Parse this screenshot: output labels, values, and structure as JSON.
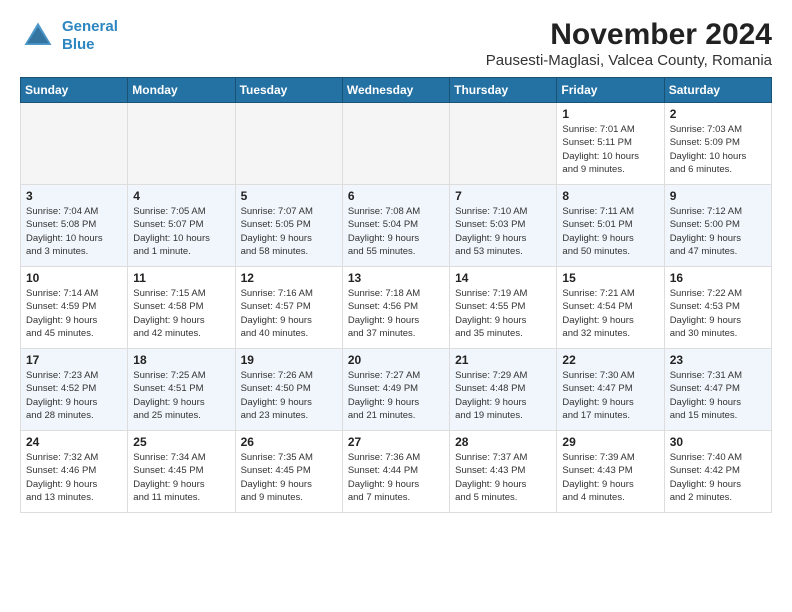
{
  "header": {
    "logo_line1": "General",
    "logo_line2": "Blue",
    "title": "November 2024",
    "subtitle": "Pausesti-Maglasi, Valcea County, Romania"
  },
  "days_of_week": [
    "Sunday",
    "Monday",
    "Tuesday",
    "Wednesday",
    "Thursday",
    "Friday",
    "Saturday"
  ],
  "weeks": [
    [
      {
        "day": "",
        "info": ""
      },
      {
        "day": "",
        "info": ""
      },
      {
        "day": "",
        "info": ""
      },
      {
        "day": "",
        "info": ""
      },
      {
        "day": "",
        "info": ""
      },
      {
        "day": "1",
        "info": "Sunrise: 7:01 AM\nSunset: 5:11 PM\nDaylight: 10 hours\nand 9 minutes."
      },
      {
        "day": "2",
        "info": "Sunrise: 7:03 AM\nSunset: 5:09 PM\nDaylight: 10 hours\nand 6 minutes."
      }
    ],
    [
      {
        "day": "3",
        "info": "Sunrise: 7:04 AM\nSunset: 5:08 PM\nDaylight: 10 hours\nand 3 minutes."
      },
      {
        "day": "4",
        "info": "Sunrise: 7:05 AM\nSunset: 5:07 PM\nDaylight: 10 hours\nand 1 minute."
      },
      {
        "day": "5",
        "info": "Sunrise: 7:07 AM\nSunset: 5:05 PM\nDaylight: 9 hours\nand 58 minutes."
      },
      {
        "day": "6",
        "info": "Sunrise: 7:08 AM\nSunset: 5:04 PM\nDaylight: 9 hours\nand 55 minutes."
      },
      {
        "day": "7",
        "info": "Sunrise: 7:10 AM\nSunset: 5:03 PM\nDaylight: 9 hours\nand 53 minutes."
      },
      {
        "day": "8",
        "info": "Sunrise: 7:11 AM\nSunset: 5:01 PM\nDaylight: 9 hours\nand 50 minutes."
      },
      {
        "day": "9",
        "info": "Sunrise: 7:12 AM\nSunset: 5:00 PM\nDaylight: 9 hours\nand 47 minutes."
      }
    ],
    [
      {
        "day": "10",
        "info": "Sunrise: 7:14 AM\nSunset: 4:59 PM\nDaylight: 9 hours\nand 45 minutes."
      },
      {
        "day": "11",
        "info": "Sunrise: 7:15 AM\nSunset: 4:58 PM\nDaylight: 9 hours\nand 42 minutes."
      },
      {
        "day": "12",
        "info": "Sunrise: 7:16 AM\nSunset: 4:57 PM\nDaylight: 9 hours\nand 40 minutes."
      },
      {
        "day": "13",
        "info": "Sunrise: 7:18 AM\nSunset: 4:56 PM\nDaylight: 9 hours\nand 37 minutes."
      },
      {
        "day": "14",
        "info": "Sunrise: 7:19 AM\nSunset: 4:55 PM\nDaylight: 9 hours\nand 35 minutes."
      },
      {
        "day": "15",
        "info": "Sunrise: 7:21 AM\nSunset: 4:54 PM\nDaylight: 9 hours\nand 32 minutes."
      },
      {
        "day": "16",
        "info": "Sunrise: 7:22 AM\nSunset: 4:53 PM\nDaylight: 9 hours\nand 30 minutes."
      }
    ],
    [
      {
        "day": "17",
        "info": "Sunrise: 7:23 AM\nSunset: 4:52 PM\nDaylight: 9 hours\nand 28 minutes."
      },
      {
        "day": "18",
        "info": "Sunrise: 7:25 AM\nSunset: 4:51 PM\nDaylight: 9 hours\nand 25 minutes."
      },
      {
        "day": "19",
        "info": "Sunrise: 7:26 AM\nSunset: 4:50 PM\nDaylight: 9 hours\nand 23 minutes."
      },
      {
        "day": "20",
        "info": "Sunrise: 7:27 AM\nSunset: 4:49 PM\nDaylight: 9 hours\nand 21 minutes."
      },
      {
        "day": "21",
        "info": "Sunrise: 7:29 AM\nSunset: 4:48 PM\nDaylight: 9 hours\nand 19 minutes."
      },
      {
        "day": "22",
        "info": "Sunrise: 7:30 AM\nSunset: 4:47 PM\nDaylight: 9 hours\nand 17 minutes."
      },
      {
        "day": "23",
        "info": "Sunrise: 7:31 AM\nSunset: 4:47 PM\nDaylight: 9 hours\nand 15 minutes."
      }
    ],
    [
      {
        "day": "24",
        "info": "Sunrise: 7:32 AM\nSunset: 4:46 PM\nDaylight: 9 hours\nand 13 minutes."
      },
      {
        "day": "25",
        "info": "Sunrise: 7:34 AM\nSunset: 4:45 PM\nDaylight: 9 hours\nand 11 minutes."
      },
      {
        "day": "26",
        "info": "Sunrise: 7:35 AM\nSunset: 4:45 PM\nDaylight: 9 hours\nand 9 minutes."
      },
      {
        "day": "27",
        "info": "Sunrise: 7:36 AM\nSunset: 4:44 PM\nDaylight: 9 hours\nand 7 minutes."
      },
      {
        "day": "28",
        "info": "Sunrise: 7:37 AM\nSunset: 4:43 PM\nDaylight: 9 hours\nand 5 minutes."
      },
      {
        "day": "29",
        "info": "Sunrise: 7:39 AM\nSunset: 4:43 PM\nDaylight: 9 hours\nand 4 minutes."
      },
      {
        "day": "30",
        "info": "Sunrise: 7:40 AM\nSunset: 4:42 PM\nDaylight: 9 hours\nand 2 minutes."
      }
    ]
  ]
}
